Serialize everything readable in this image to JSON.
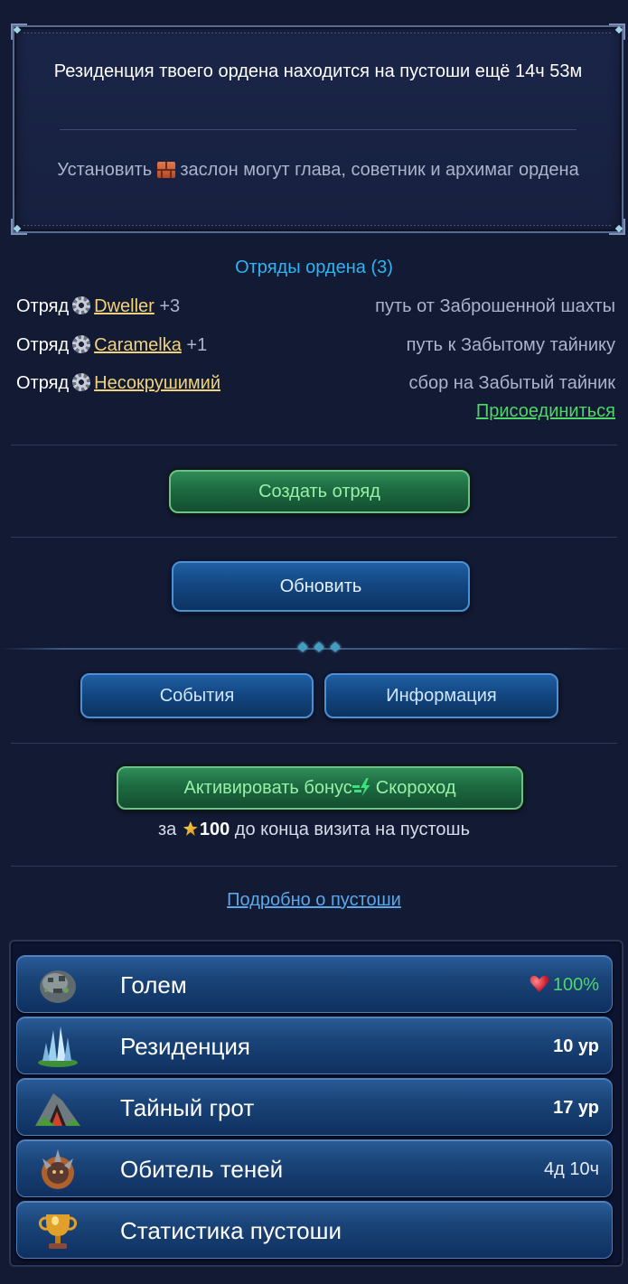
{
  "notice": {
    "title": "Резиденция твоего ордена находится на пустоши ещё 14ч 53м",
    "note_before": "Установить",
    "note_after": "заслон могут глава, советник и архимаг ордена"
  },
  "squads": {
    "title": "Отряды ордена (3)",
    "rows": [
      {
        "word": "Отряд",
        "name": "Dweller",
        "bonus": "+3",
        "status": "путь от Заброшенной шахты"
      },
      {
        "word": "Отряд",
        "name": "Caramelka",
        "bonus": "+1",
        "status": "путь к Забытому тайнику"
      },
      {
        "word": "Отряд",
        "name": "Несокрушимий",
        "bonus": "",
        "status": "сбор на Забытый тайник"
      }
    ],
    "join_label": "Присоединиться"
  },
  "actions": {
    "create_squad": "Создать отряд",
    "refresh": "Обновить",
    "events": "События",
    "info": "Информация"
  },
  "bonus": {
    "button_text": "Активировать бонус",
    "button_name": "Скороход",
    "note_prefix": "за",
    "amount": "100",
    "note_suffix": "до конца визита на пустошь"
  },
  "more_link": "Подробно о пустоши",
  "nav": {
    "items": [
      {
        "label": "Голем",
        "value": "100%",
        "icon": "golem-icon"
      },
      {
        "label": "Резиденция",
        "value": "10 ур",
        "icon": "residence-icon"
      },
      {
        "label": "Тайный грот",
        "value": "17 ур",
        "icon": "grotto-icon"
      },
      {
        "label": "Обитель теней",
        "value": "4д 10ч",
        "icon": "shadow-abode-icon"
      },
      {
        "label": "Статистика пустоши",
        "value": "",
        "icon": "trophy-icon"
      }
    ]
  },
  "colors": {
    "background": "#131a33",
    "accent_blue": "#2fb3f2",
    "link_green": "#4fd66a",
    "name_gold": "#f0d27a"
  }
}
